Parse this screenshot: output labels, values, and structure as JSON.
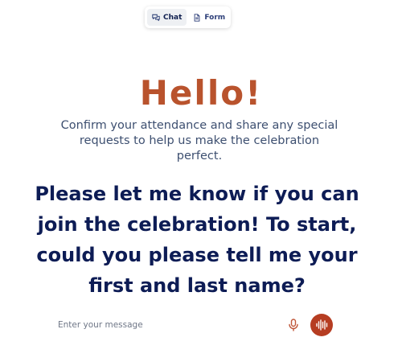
{
  "mode_toggle": {
    "chat_label": "Chat",
    "form_label": "Form",
    "active": "Chat"
  },
  "header": {
    "greeting": "Hello!",
    "subtitle": "Confirm your attendance and share any special requests to help us make the celebration perfect."
  },
  "conversation": {
    "assistant_message": "Please let me know if you can join the celebration! To start, could you please tell me your first and last name?"
  },
  "composer": {
    "placeholder": "Enter your message",
    "value": ""
  },
  "icons": {
    "chat": "chat-bubbles-icon",
    "form": "document-icon",
    "mic": "microphone-icon",
    "voice": "soundwave-icon"
  },
  "colors": {
    "accent": "#b9532d",
    "voice_button": "#b63d22",
    "heading": "#0d1c55",
    "subtitle": "#3d4f70"
  }
}
